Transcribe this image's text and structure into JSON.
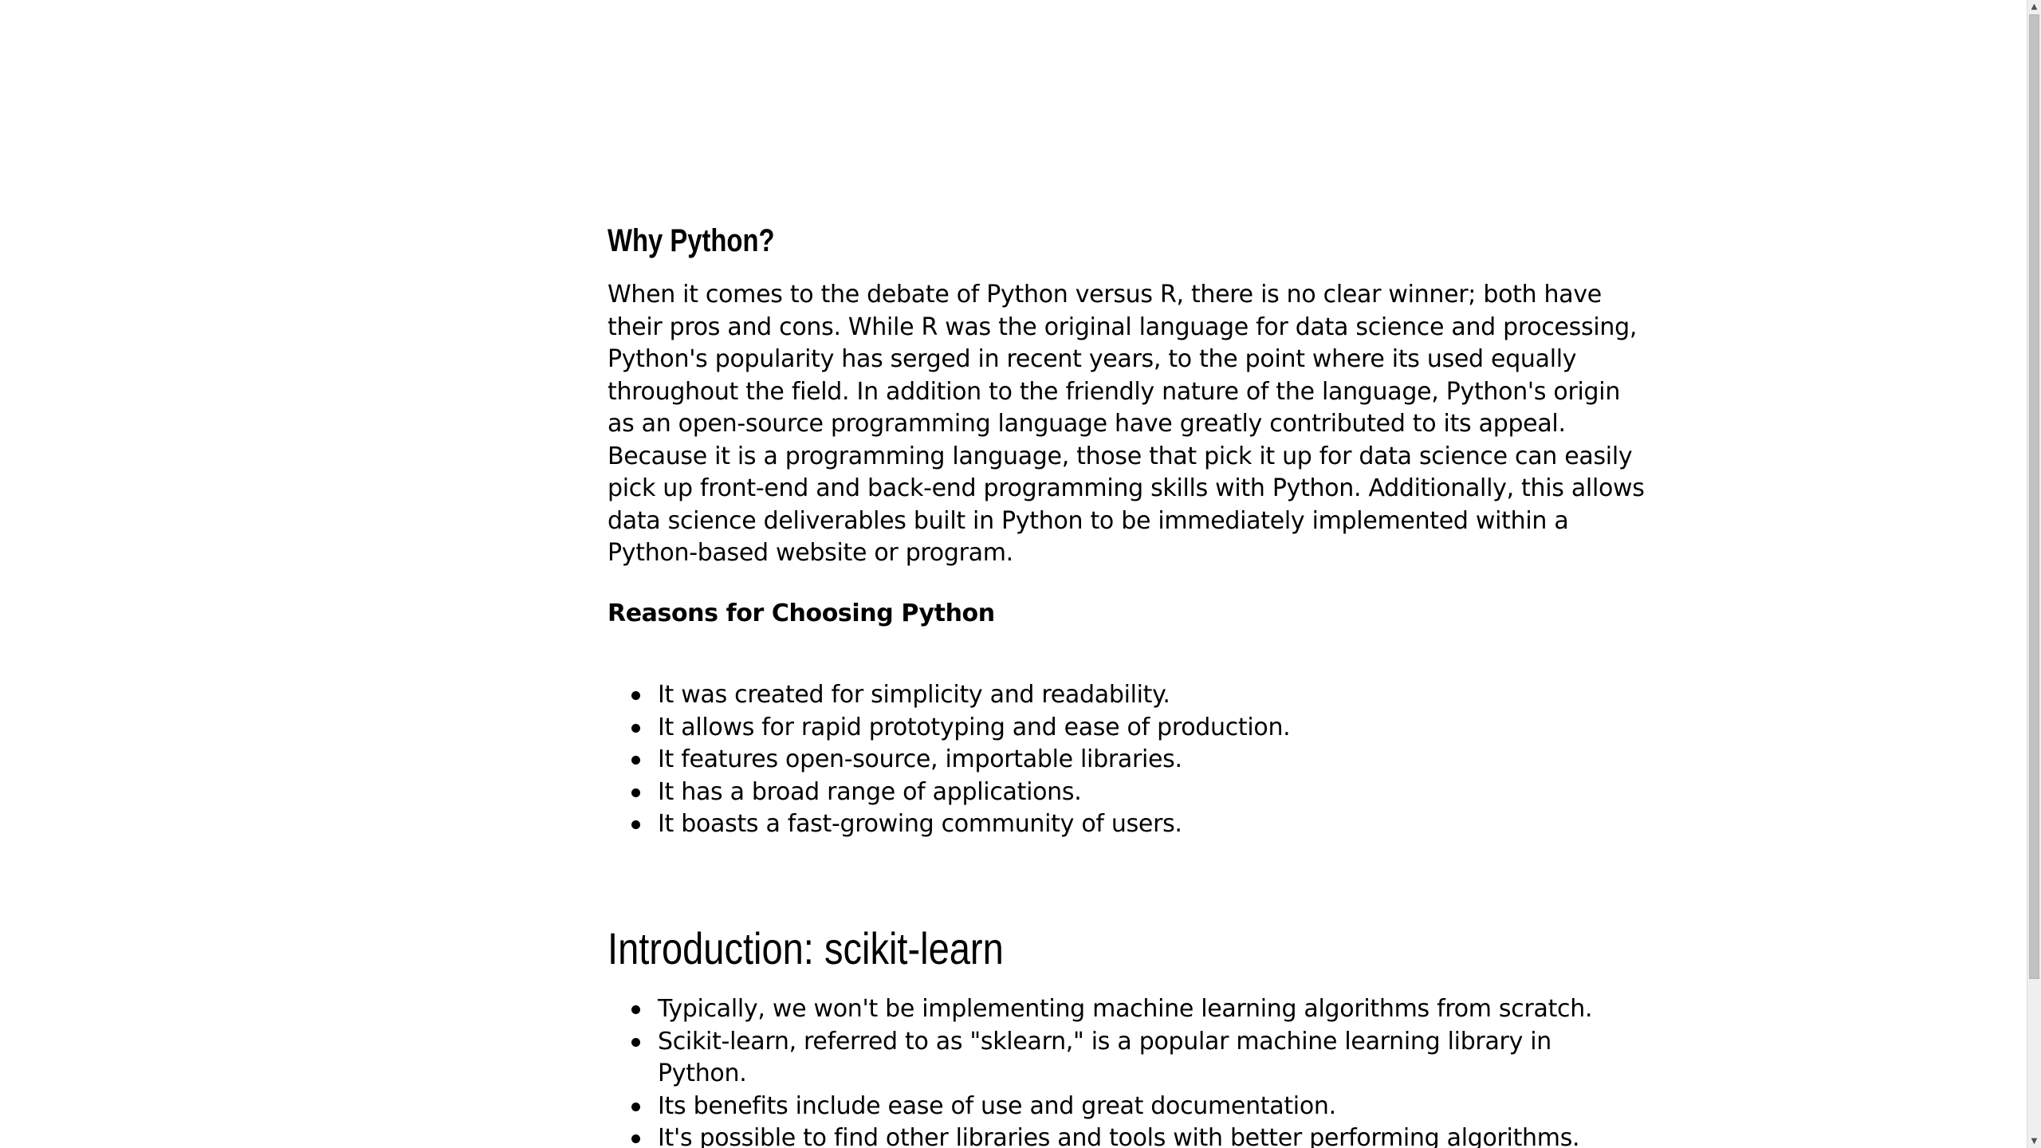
{
  "why_python": {
    "heading": "Why Python?",
    "paragraph_lines": [
      "When it comes to the debate of Python versus R, there is no clear winner; both have",
      "their pros and cons. While R was the original language for data science and processing,",
      "Python's popularity has serged in recent years, to the point where its used equally",
      "throughout the field. In addition to the friendly nature of the language, Python's origin",
      "as an open-source programming language have greatly contributed to its appeal.",
      "Because it is a programming language, those that pick it up for data science can easily",
      "pick up front-end and back-end programming skills with Python. Additionally, this allows",
      "data science deliverables built in Python to be immediately implemented within a",
      "Python-based website or program."
    ],
    "reasons_heading": "Reasons for Choosing Python",
    "reasons": [
      "It was created for simplicity and readability.",
      "It allows for rapid prototyping and ease of production.",
      "It features open-source, importable libraries.",
      "It has a broad range of applications.",
      "It boasts a fast-growing community of users."
    ]
  },
  "intro_sklearn": {
    "heading": "Introduction: scikit-learn",
    "items": [
      "Typically, we won't be implementing machine learning algorithms from scratch.",
      "Scikit-learn, referred to as \"sklearn,\" is a popular machine learning library in",
      "Python.",
      "Its benefits include ease of use and great documentation.",
      "It's possible to find other libraries and tools with better performing algorithms."
    ]
  },
  "scrollbar": {
    "up_icon": "triangle-up-icon",
    "down_icon": "triangle-down-icon"
  }
}
